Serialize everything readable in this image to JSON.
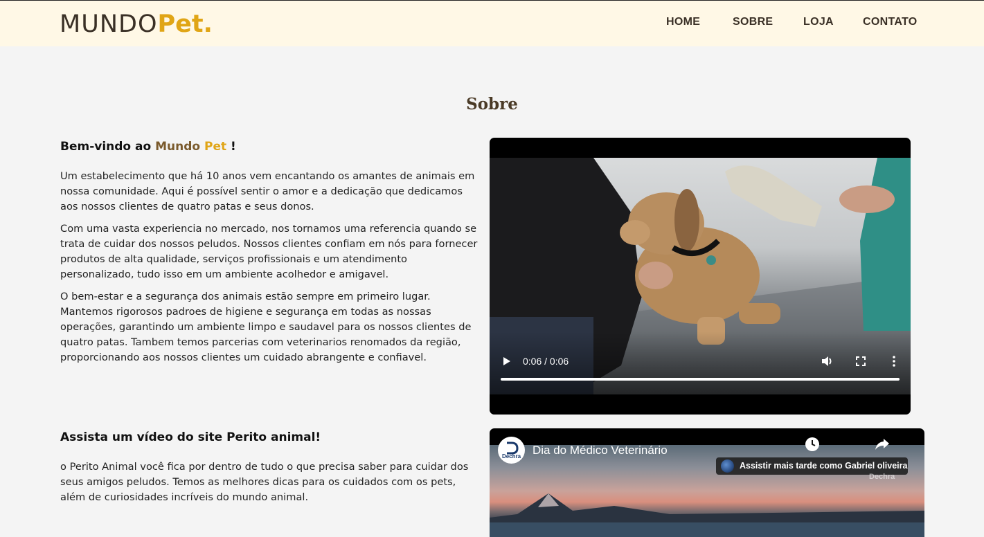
{
  "header": {
    "logo_mundo": "MUNDO",
    "logo_pet": "Pet.",
    "nav": [
      "HOME",
      "SOBRE",
      "LOJA",
      "CONTATO"
    ]
  },
  "about": {
    "title": "Sobre",
    "welcome_prefix": "Bem-vindo ao ",
    "welcome_mundo": "Mundo",
    "welcome_pet": "Pet",
    "welcome_suffix": " !",
    "paragraphs": [
      "Um estabelecimento que há 10 anos vem encantando os amantes de animais em nossa comunidade. Aqui é possível sentir o amor e a dedicação que dedicamos aos nossos clientes de quatro patas e seus donos.",
      "Com uma vasta experiencia no mercado, nos tornamos uma referencia quando se trata de cuidar dos nossos peludos. Nossos clientes confiam em nós para fornecer produtos de alta qualidade, serviços profissionais e um atendimento personalizado, tudo isso em um ambiente acolhedor e amigavel.",
      "O bem-estar e a segurança dos animais estão sempre em primeiro lugar. Mantemos rigorosos padroes de higiene e segurança em todas as nossas operações, garantindo um ambiente limpo e saudavel para os nossos clientes de quatro patas. Tambem temos parcerias com veterinarios renomados da região, proporcionando aos nossos clientes um cuidado abrangente e confiavel."
    ]
  },
  "video1": {
    "time": "0:06 / 0:06",
    "progress": 1.0
  },
  "video_section": {
    "heading": "Assista um vídeo do site Perito animal!",
    "paragraph": "o Perito Animal você fica por dentro de tudo o que precisa saber para cuidar dos seus amigos peludos. Temos as melhores dicas para os cuidados com os pets, além de curiosidades incríveis do mundo animal."
  },
  "video2": {
    "title": "Dia do Médico Veterinário",
    "channel": "Dechra",
    "watch_later": "Assistir mais tarde como Gabriel oliveira",
    "watermark": "Dechra"
  },
  "colors": {
    "header_bg": "#fff8e6",
    "accent": "#e0a516",
    "brown": "#7a5a2c"
  }
}
